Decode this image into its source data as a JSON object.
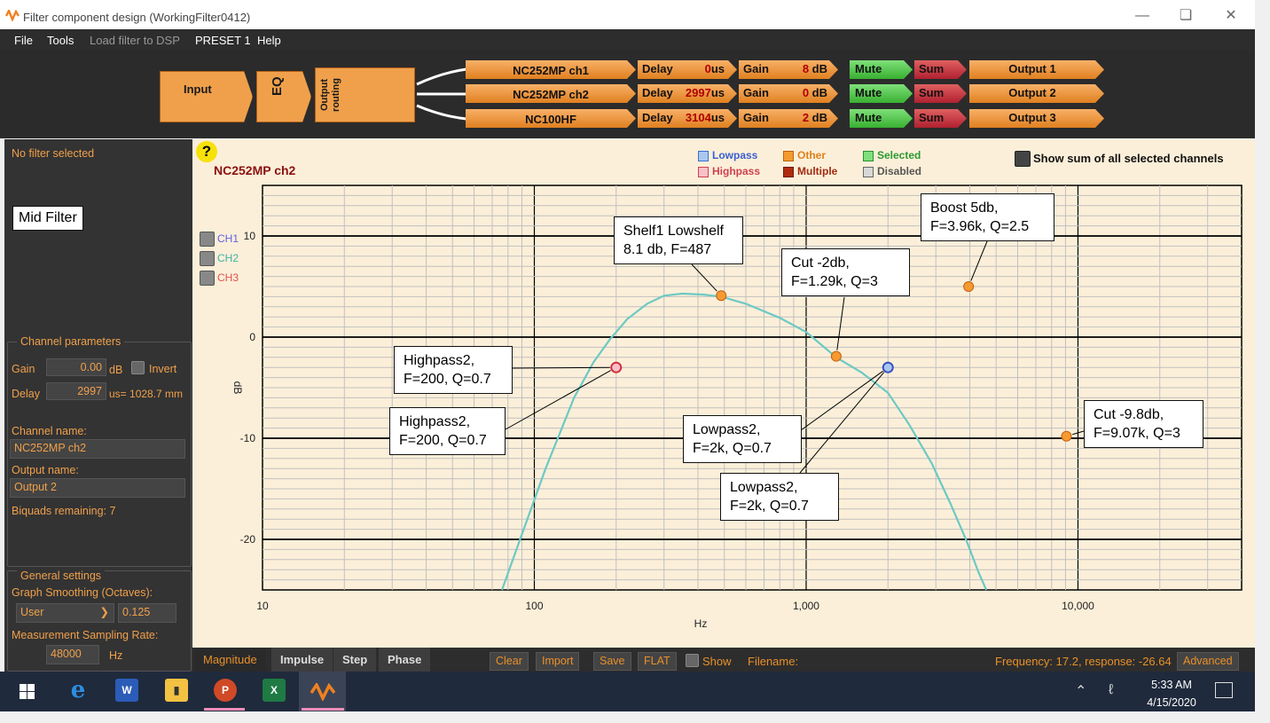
{
  "window": {
    "title": "Filter component design (WorkingFilter0412)"
  },
  "menu": [
    "File",
    "Tools",
    "Load filter to DSP",
    "PRESET 1",
    "Help"
  ],
  "pipeline": {
    "input_label": "Input",
    "eq_label": "EQ",
    "routing_label": "Output routing",
    "channels": [
      {
        "name": "NC252MP ch1",
        "delay_label": "Delay",
        "delay": "0",
        "delay_unit": "us",
        "gain_label": "Gain",
        "gain": "8",
        "gain_unit": "dB",
        "mute": "Mute",
        "sum": "Sum",
        "output": "Output 1"
      },
      {
        "name": "NC252MP ch2",
        "delay_label": "Delay",
        "delay": "2997",
        "delay_unit": "us",
        "gain_label": "Gain",
        "gain": "0",
        "gain_unit": "dB",
        "mute": "Mute",
        "sum": "Sum",
        "output": "Output 2"
      },
      {
        "name": "NC100HF",
        "delay_label": "Delay",
        "delay": "3104",
        "delay_unit": "us",
        "gain_label": "Gain",
        "gain": "2",
        "gain_unit": "dB",
        "mute": "Mute",
        "sum": "Sum",
        "output": "Output 3"
      }
    ]
  },
  "sidebar": {
    "no_filter": "No filter selected",
    "mid_filter": "Mid Filter",
    "channel_params_title": "Channel parameters",
    "gain_label": "Gain",
    "gain_value": "0.00",
    "gain_unit": "dB",
    "invert_label": "Invert",
    "delay_label": "Delay",
    "delay_value": "2997",
    "delay_unit": "us= 1028.7 mm",
    "channel_name_label": "Channel name:",
    "channel_name": "NC252MP ch2",
    "output_name_label": "Output name:",
    "output_name": "Output 2",
    "biquads": "Biquads remaining: 7",
    "general_title": "General settings",
    "smoothing_label": "Graph Smoothing (Octaves):",
    "smoothing_mode": "User",
    "smoothing_value": "0.125",
    "sampling_label": "Measurement Sampling Rate:",
    "sampling_value": "48000",
    "sampling_unit": "Hz"
  },
  "graph": {
    "help_icon": "?",
    "channel_title": "NC252MP ch2",
    "legend": [
      {
        "label": "Lowpass",
        "color": "#a9c8f0",
        "border": "#3a6fd0"
      },
      {
        "label": "Highpass",
        "color": "#f8c0c8",
        "border": "#d04050"
      },
      {
        "label": "Other",
        "color": "#f59a30",
        "border": "#c06010"
      },
      {
        "label": "Multiple",
        "color": "#b02a10",
        "border": "#701808"
      },
      {
        "label": "Selected",
        "color": "#7ee07a",
        "border": "#2a9030"
      },
      {
        "label": "Disabled",
        "color": "#d8d8d8",
        "border": "#666666"
      }
    ],
    "show_sum_label": "Show sum of all selected channels",
    "channel_toggles": [
      {
        "label": "CH1",
        "color": "#6060e0"
      },
      {
        "label": "CH2",
        "color": "#40b0a8"
      },
      {
        "label": "CH3",
        "color": "#e05050"
      }
    ],
    "colors": {
      "curve": "#6cc9c4",
      "gridMajor": "#000000",
      "gridMinor": "#c0c0c0"
    },
    "callouts": [
      {
        "lines": [
          "Shelf1 Lowshelf",
          "8.1 db, F=487"
        ]
      },
      {
        "lines": [
          "Boost 5db,",
          "F=3.96k, Q=2.5"
        ]
      },
      {
        "lines": [
          "Cut -2db,",
          "F=1.29k, Q=3"
        ]
      },
      {
        "lines": [
          "Highpass2,",
          "F=200, Q=0.7"
        ]
      },
      {
        "lines": [
          "Highpass2,",
          "F=200, Q=0.7"
        ]
      },
      {
        "lines": [
          "Lowpass2,",
          "F=2k, Q=0.7"
        ]
      },
      {
        "lines": [
          "Lowpass2,",
          "F=2k, Q=0.7"
        ]
      },
      {
        "lines": [
          "Cut -9.8db,",
          "F=9.07k, Q=3"
        ]
      }
    ]
  },
  "chart_data": {
    "type": "line",
    "xlabel": "Hz",
    "ylabel": "dB",
    "xscale": "log",
    "xlim": [
      10,
      40000
    ],
    "ylim": [
      -25,
      15
    ],
    "x_ticks": [
      {
        "value": 10,
        "label": "10"
      },
      {
        "value": 100,
        "label": "100"
      },
      {
        "value": 1000,
        "label": "1,000"
      },
      {
        "value": 10000,
        "label": "10,000"
      }
    ],
    "y_ticks": [
      10,
      0,
      -10,
      -20
    ],
    "series": [
      {
        "x": [
          76,
          90,
          110,
          140,
          165,
          190,
          220,
          260,
          300,
          350,
          420,
          487,
          600,
          800,
          1000,
          1290,
          1600,
          2000,
          2400,
          2900,
          3400,
          3900,
          4300,
          4600
        ],
        "y": [
          -25,
          -19.5,
          -13,
          -6,
          -2.5,
          -0.2,
          1.8,
          3.3,
          4.1,
          4.3,
          4.2,
          4.0,
          3.3,
          1.9,
          0.5,
          -2.0,
          -3.5,
          -5.5,
          -8.7,
          -12.5,
          -16.5,
          -20.2,
          -23.2,
          -25
        ]
      }
    ],
    "markers": [
      {
        "x": 487,
        "y": 4.1,
        "kind": "Other"
      },
      {
        "x": 1290,
        "y": -1.9,
        "kind": "Other"
      },
      {
        "x": 3960,
        "y": 5.0,
        "kind": "Other"
      },
      {
        "x": 9070,
        "y": -9.8,
        "kind": "Other"
      },
      {
        "x": 200,
        "y": -3.0,
        "kind": "Highpass"
      },
      {
        "x": 2000,
        "y": -3.0,
        "kind": "Lowpass"
      }
    ]
  },
  "bottom": {
    "tabs": [
      "Magnitude",
      "Impulse",
      "Step",
      "Phase"
    ],
    "buttons": [
      "Clear",
      "Import",
      "Save",
      "FLAT"
    ],
    "show_label": "Show",
    "filename_label": "Filename:",
    "status": "Frequency: 17.2, response: -26.64",
    "advanced": "Advanced"
  },
  "taskbar": {
    "time": "5:33 AM",
    "date": "4/15/2020"
  }
}
